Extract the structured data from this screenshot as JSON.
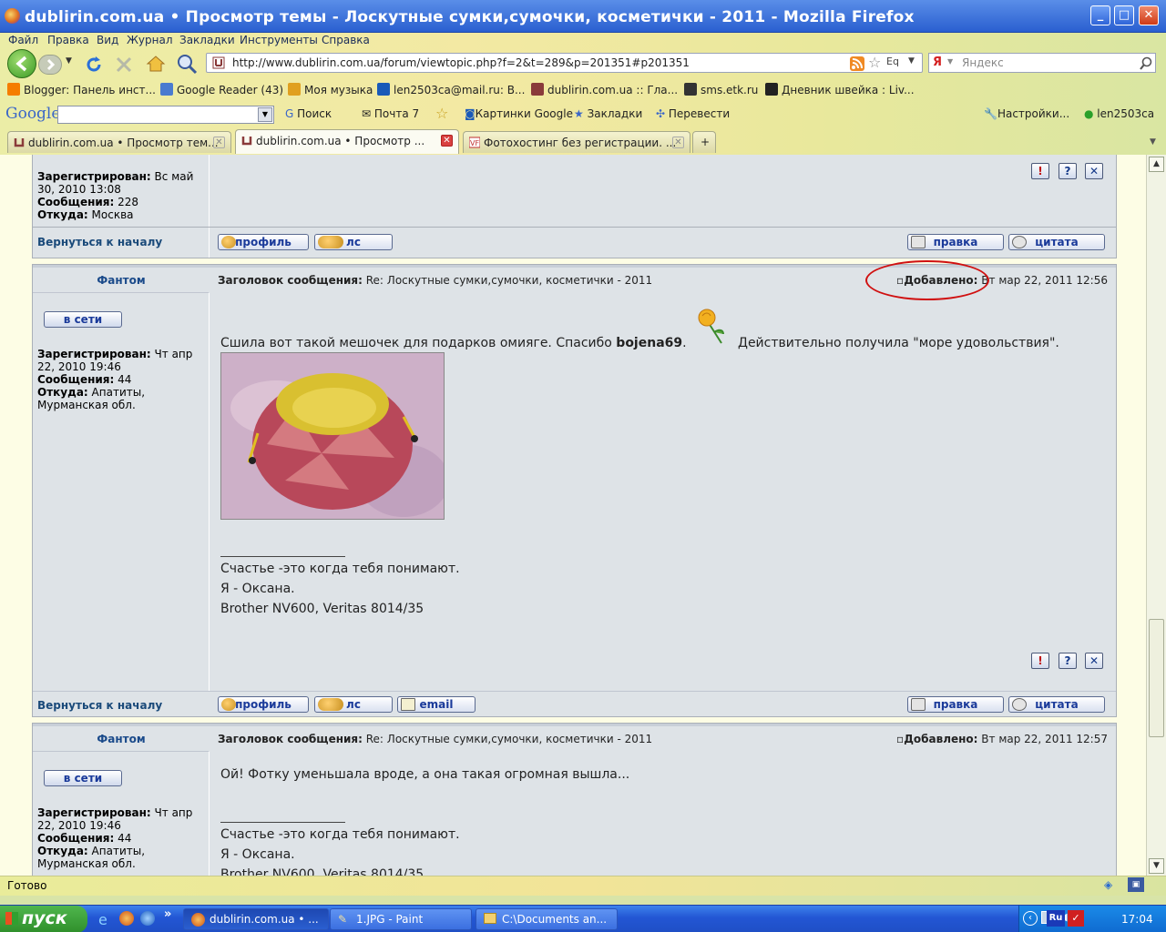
{
  "window": {
    "title": "dublirin.com.ua • Просмотр темы - Лоскутные сумки,сумочки, косметички - 2011 - Mozilla Firefox",
    "controls": [
      "_",
      "□",
      "✕"
    ]
  },
  "menu": [
    "Файл",
    "Правка",
    "Вид",
    "Журнал",
    "Закладки",
    "Инструменты",
    "Справка"
  ],
  "nav": {
    "url": "http://www.dublirin.com.ua/forum/viewtopic.php?f=2&t=289&p=201351#p201351",
    "search_placeholder": "Яндекс"
  },
  "bookmarks": [
    {
      "label": "Blogger: Панель инст...",
      "icon": "blogger-icon",
      "color": "#f57d00"
    },
    {
      "label": "Google Reader (43)",
      "icon": "google-reader-icon",
      "color": "#4a7bd0"
    },
    {
      "label": "Моя музыка",
      "icon": "music-icon",
      "color": "#e0a020"
    },
    {
      "label": "len2503ca@mail.ru: В...",
      "icon": "mail-icon",
      "color": "#1a5ab8"
    },
    {
      "label": "dublirin.com.ua :: Гла...",
      "icon": "dublirin-icon",
      "color": "#8a3a3a"
    },
    {
      "label": "sms.etk.ru",
      "icon": "sms-icon",
      "color": "#333333"
    },
    {
      "label": "Дневник швейка : Liv...",
      "icon": "liveinternet-icon",
      "color": "#222222"
    }
  ],
  "google_bar": {
    "logo": "Google",
    "items": [
      "Поиск",
      "Почта 7",
      "Картинки Google",
      "Закладки",
      "Перевести",
      "Настройки...",
      "len2503ca"
    ]
  },
  "tabs": [
    {
      "label": "dublirin.com.ua • Просмотр тем...",
      "active": false
    },
    {
      "label": "dublirin.com.ua • Просмотр ...",
      "active": true
    },
    {
      "label": "Фотохостинг без регистрации. ...",
      "active": false
    }
  ],
  "posts": {
    "prev": {
      "registered_label": "Зарегистрирован:",
      "registered": "Вс май 30, 2010 13:08",
      "messages_label": "Сообщения:",
      "messages": "228",
      "from_label": "Откуда:",
      "from": "Москва"
    },
    "back_to_top": "Вернуться к началу",
    "buttons": {
      "profile": "профиль",
      "pm": "лс",
      "email": "email",
      "edit": "правка",
      "quote": "цитата",
      "online": "в сети"
    },
    "subject_label": "Заголовок сообщения:",
    "added_label": "Добавлено:",
    "p1": {
      "author": "Фантом",
      "subject": "Re: Лоскутные сумки,сумочки, косметички - 2011",
      "date": "Вт мар 22, 2011 12:56",
      "registered": "Чт апр 22, 2010 19:46",
      "messages": "44",
      "from": "Апатиты, Мурманская обл.",
      "text_a": "Сшила вот такой мешочек для подарков омияге. Спасибо ",
      "text_bold": "bojena69",
      "text_b": ".",
      "text_c": "Действительно получила \"море удовольствия\"."
    },
    "sig": [
      "Счастье -это когда тебя понимают.",
      "Я - Оксана.",
      "Brother NV600, Veritas 8014/35"
    ],
    "p2": {
      "author": "Фантом",
      "subject": "Re: Лоскутные сумки,сумочки, косметички - 2011",
      "date": "Вт мар 22, 2011 12:57",
      "registered": "Чт апр 22, 2010 19:46",
      "messages": "44",
      "from": "Апатиты, Мурманская обл.",
      "text": "Ой! Фотку уменьшала вроде, а она такая огромная вышла..."
    }
  },
  "status": "Готово",
  "taskbar": {
    "start": "пуск",
    "items": [
      "dublirin.com.ua • ...",
      "1.JPG - Paint",
      "C:\\Documents an..."
    ],
    "lang": "RU",
    "clock": "17:04"
  },
  "colors": {
    "annotation": "#d01010",
    "post_bg": "#dee3e7",
    "link": "#1a4a8a"
  }
}
